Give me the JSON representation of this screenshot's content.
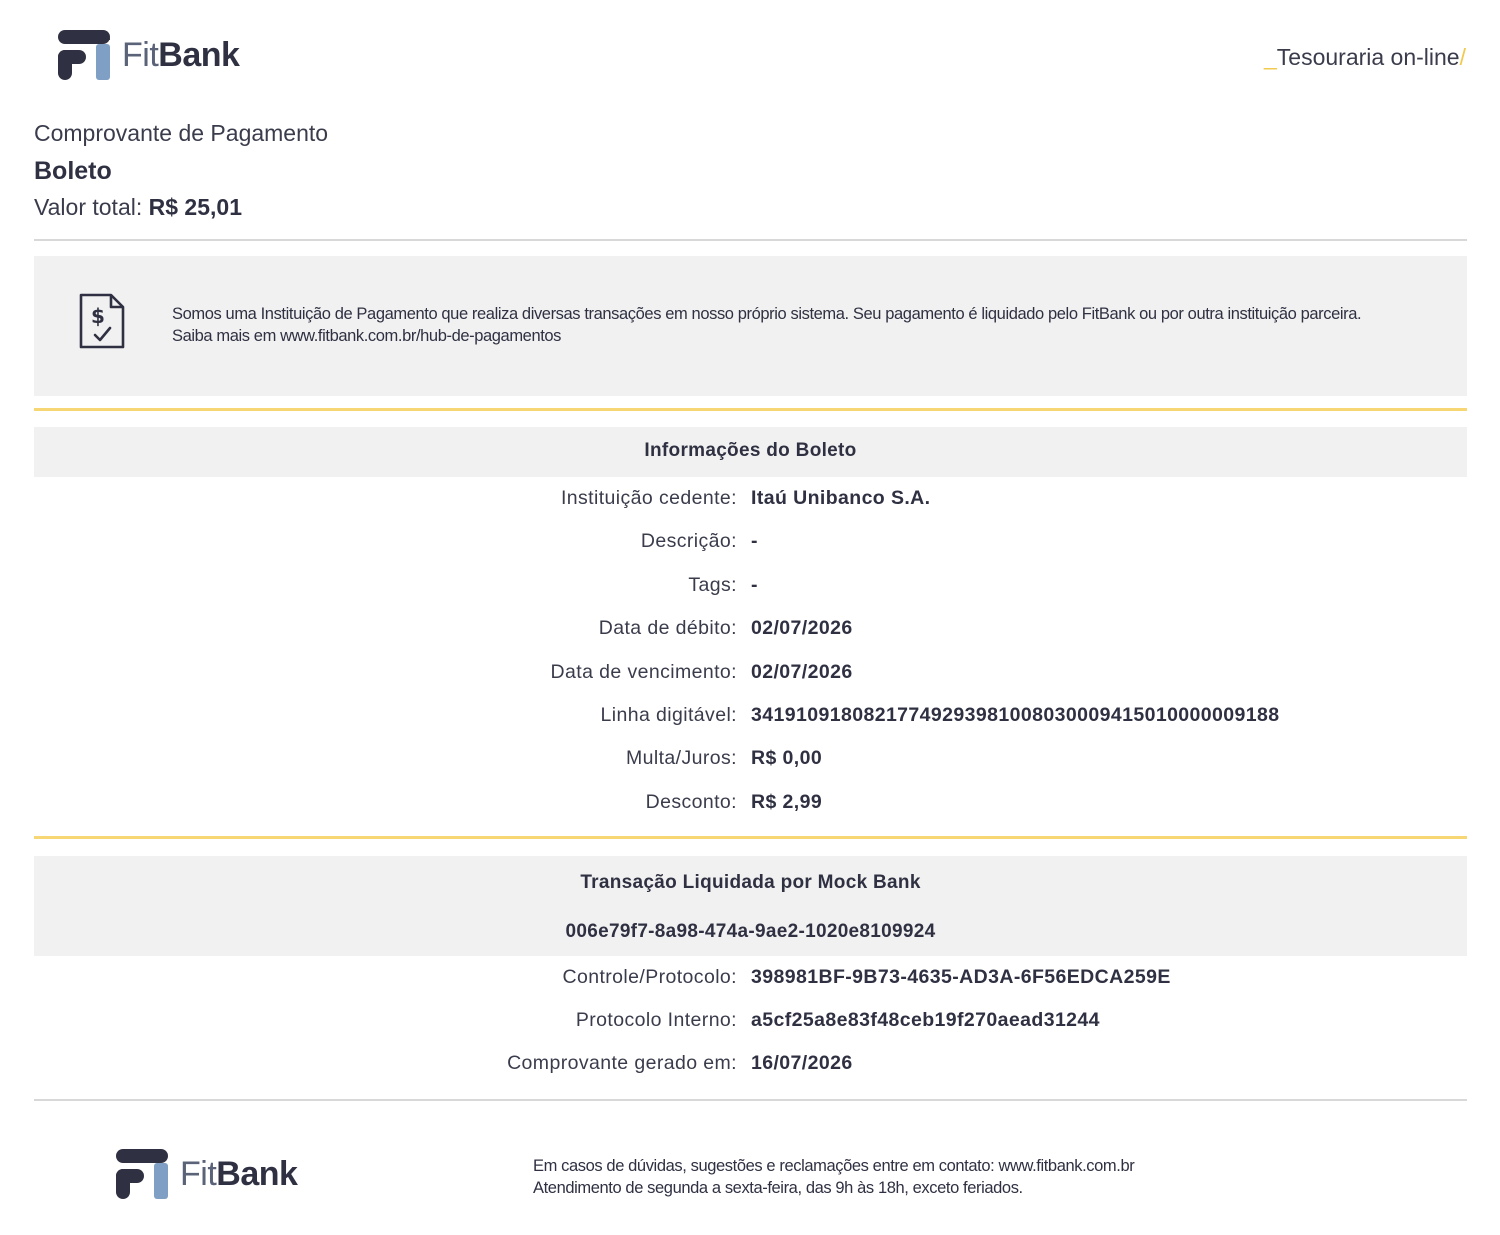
{
  "header": {
    "logo_fit": "Fit",
    "logo_bank": "Bank",
    "tagline_prefix": "_",
    "tagline": "Tesouraria on-line",
    "tagline_suffix": "/"
  },
  "title": {
    "kind": "Comprovante de Pagamento",
    "type": "Boleto",
    "total_label": "Valor total:",
    "total_value": "R$ 25,01"
  },
  "notice": {
    "icon": "receipt-dollar-icon",
    "line1": "Somos uma Instituição de Pagamento que realiza diversas transações em nosso próprio sistema. Seu pagamento é liquidado pelo FitBank ou por outra instituição parceira.",
    "line2": "Saiba mais em www.fitbank.com.br/hub-de-pagamentos"
  },
  "boleto_section": {
    "title": "Informações do Boleto",
    "rows": [
      {
        "label": "Instituição cedente:",
        "value": "Itaú Unibanco S.A."
      },
      {
        "label": "Descrição:",
        "value": "-"
      },
      {
        "label": "Tags:",
        "value": "-"
      },
      {
        "label": "Data de débito:",
        "value": "02/07/2026"
      },
      {
        "label": "Data de vencimento:",
        "value": "02/07/2026"
      },
      {
        "label": "Linha digitável:",
        "value": "34191091808217749293981008030009415010000009188"
      },
      {
        "label": "Multa/Juros:",
        "value": "R$ 0,00"
      },
      {
        "label": "Desconto:",
        "value": "R$ 2,99"
      }
    ]
  },
  "transaction_section": {
    "title": "Transação Liquidada por Mock Bank",
    "id": "006e79f7-8a98-474a-9ae2-1020e8109924",
    "rows": [
      {
        "label": "Controle/Protocolo:",
        "value": "398981BF-9B73-4635-AD3A-6F56EDCA259E"
      },
      {
        "label": "Protocolo Interno:",
        "value": "a5cf25a8e83f48ceb19f270aead31244"
      },
      {
        "label": "Comprovante gerado em:",
        "value": "16/07/2026"
      }
    ]
  },
  "footer": {
    "line1": "Em casos de dúvidas, sugestões e reclamações entre em contato: www.fitbank.com.br",
    "line2": "Atendimento de segunda a sexta-feira, das 9h às 18h, exceto feriados."
  },
  "colors": {
    "navy": "#2f3142",
    "accent_blue": "#7f9fc4",
    "accent_yellow": "#f7d774",
    "panel_gray": "#f1f1f1"
  }
}
